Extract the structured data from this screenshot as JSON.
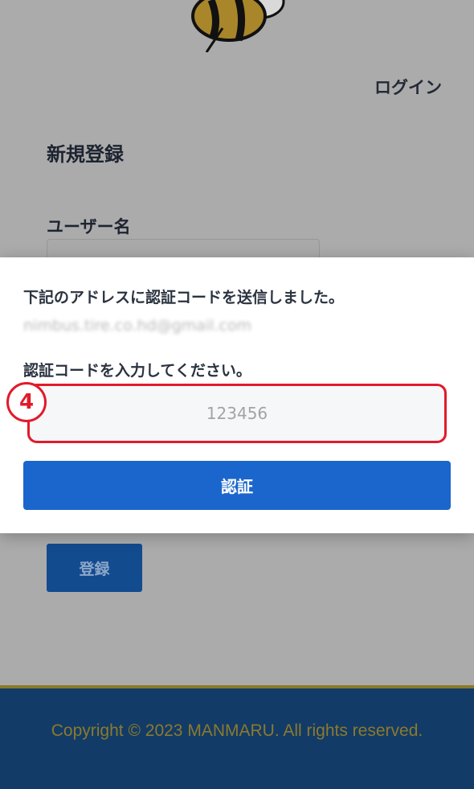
{
  "header": {
    "login_label": "ログイン"
  },
  "form": {
    "title": "新規登録",
    "username_label": "ユーザー名",
    "register_label": "登録"
  },
  "modal": {
    "message": "下記のアドレスに認証コードを送信しました。",
    "email": "nimbus.tire.co.hd@gmail.com",
    "instruction": "認証コードを入力してください。",
    "code_placeholder": "123456",
    "verify_label": "認証",
    "annotation_number": "4"
  },
  "footer": {
    "copyright": "Copyright © 2023 MANMARU. All rights reserved."
  },
  "colors": {
    "primary": "#1b66cc",
    "annotation": "#e11a2b",
    "footer_bg": "#123b68",
    "footer_text": "#8b7a2c"
  }
}
